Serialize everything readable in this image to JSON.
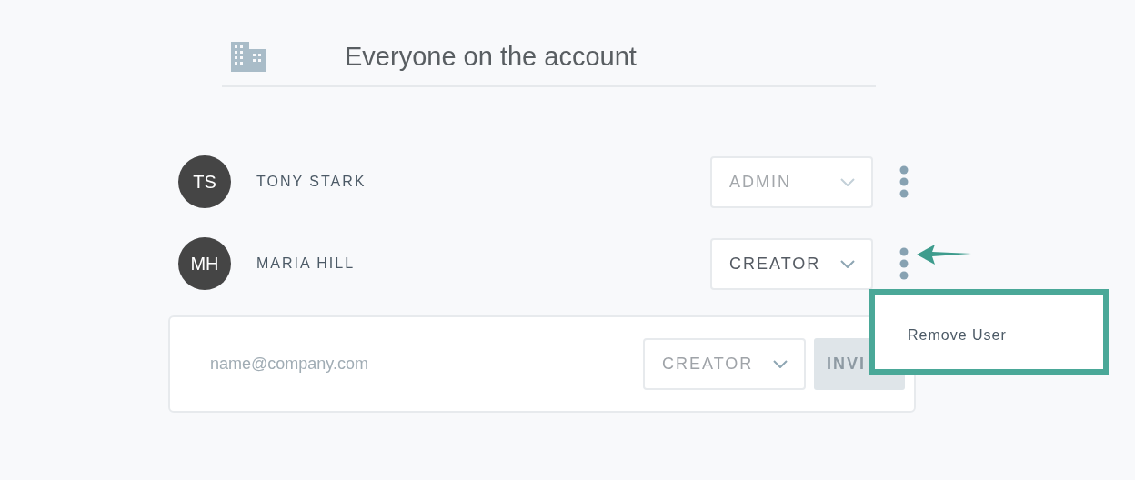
{
  "header": {
    "title": "Everyone on the account"
  },
  "users": [
    {
      "initials": "TS",
      "name": "TONY STARK",
      "role": "ADMIN",
      "disabled": true
    },
    {
      "initials": "MH",
      "name": "MARIA HILL",
      "role": "CREATOR",
      "disabled": false
    }
  ],
  "invite": {
    "placeholder": "name@company.com",
    "role": "CREATOR",
    "button": "INVI"
  },
  "menu": {
    "items": [
      "Remove User"
    ]
  }
}
